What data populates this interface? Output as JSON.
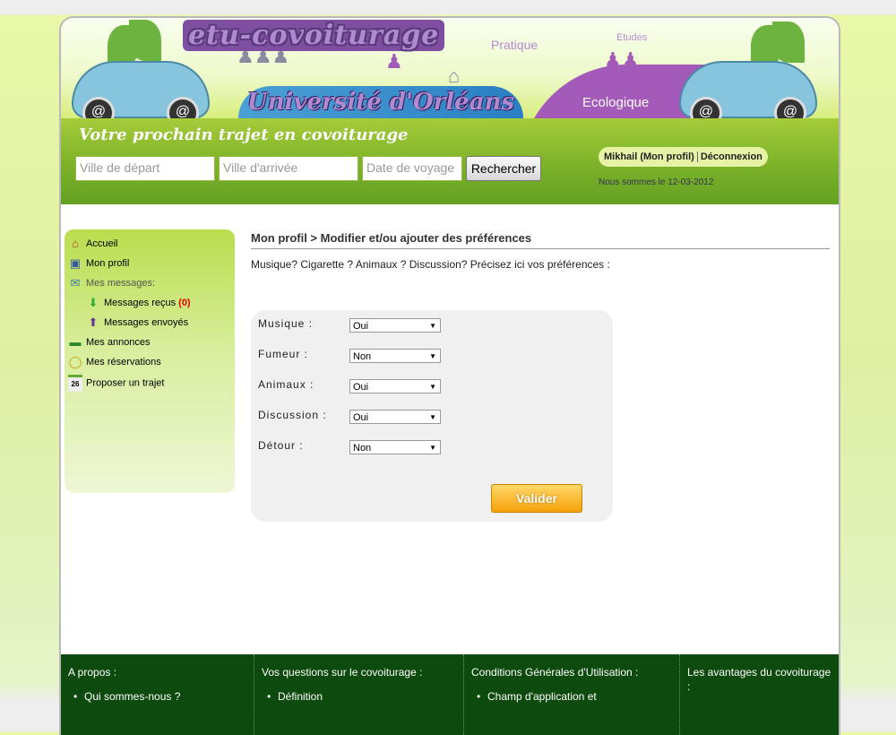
{
  "header": {
    "brand": "etu-covoiturage",
    "university": "Université d'Orléans",
    "words": {
      "pratique": "Pratique",
      "etudes": "Etudes",
      "ecologique": "Ecologique"
    }
  },
  "search": {
    "tagline": "Votre prochain trajet en covoiturage",
    "departure_placeholder": "Ville de départ",
    "arrival_placeholder": "Ville d'arrivée",
    "date_placeholder": "Date de voyage",
    "button": "Rechercher"
  },
  "user": {
    "profile_link": "Mikhail (Mon profil)",
    "logout": "Déconnexion",
    "date_text": "Nous sommes le 12-03-2012"
  },
  "sidebar": {
    "accueil": "Accueil",
    "profil": "Mon profil",
    "messages": "Mes messages:",
    "recus": "Messages reçus",
    "recus_count": "(0)",
    "envoyes": "Messages envoyés",
    "annonces": "Mes annonces",
    "reservations": "Mes réservations",
    "proposer": "Proposer un trajet",
    "calendar_day": "26"
  },
  "main": {
    "breadcrumb": "Mon profil > Modifier et/ou ajouter des préférences",
    "intro": "Musique? Cigarette ? Animaux ? Discussion? Précisez ici vos préférences :",
    "prefs": [
      {
        "label": "Musique :",
        "value": "Oui"
      },
      {
        "label": "Fumeur :",
        "value": "Non"
      },
      {
        "label": "Animaux :",
        "value": "Oui"
      },
      {
        "label": "Discussion :",
        "value": "Oui"
      },
      {
        "label": "Détour :",
        "value": "Non"
      }
    ],
    "submit": "Valider"
  },
  "footer": {
    "cols": [
      {
        "title": "A propos :",
        "item": "Qui sommes-nous ?"
      },
      {
        "title": "Vos questions sur le covoiturage :",
        "item": "Définition"
      },
      {
        "title": "Conditions Générales d'Utilisation :",
        "item": "Champ d'application et"
      },
      {
        "title": "Les avantages du covoiturage :",
        "item": ""
      }
    ]
  },
  "colors": {
    "accent_green": "#7fb42a",
    "footer_green": "#0d4a0d",
    "button_orange": "#f5a20a",
    "brand_purple": "#a35ab8"
  }
}
